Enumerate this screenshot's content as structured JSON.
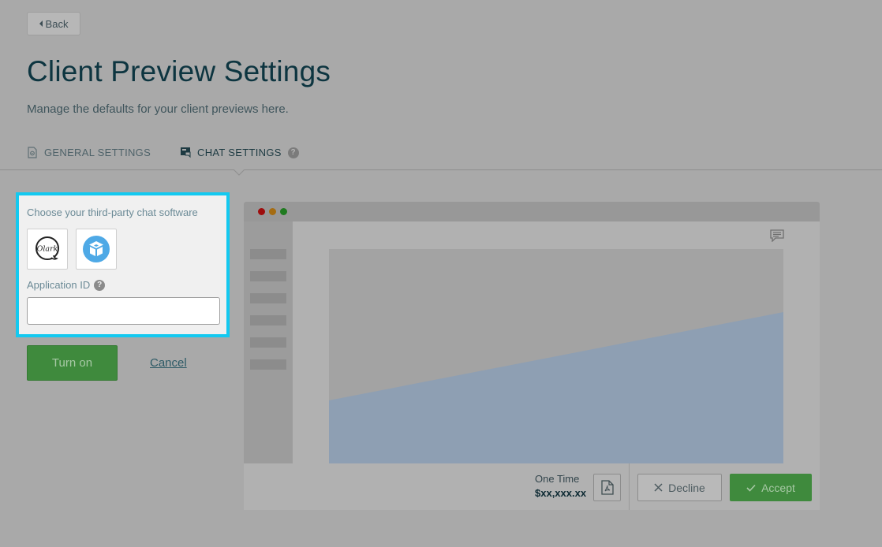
{
  "header": {
    "back_label": "Back",
    "title": "Client Preview Settings",
    "subtitle": "Manage the defaults for your client previews here."
  },
  "tabs": [
    {
      "label": "GENERAL SETTINGS",
      "active": false
    },
    {
      "label": "CHAT SETTINGS",
      "active": true
    }
  ],
  "chat_panel": {
    "prompt": "Choose your third-party chat software",
    "options": [
      {
        "name": "Olark",
        "icon": "olark-logo"
      },
      {
        "name": "",
        "icon": "blue-cube-logo"
      }
    ],
    "appid_label": "Application ID",
    "appid_value": "",
    "appid_placeholder": ""
  },
  "actions": {
    "turn_on_label": "Turn on",
    "cancel_label": "Cancel"
  },
  "preview": {
    "price_label": "One Time",
    "price_value": "$xx,xxx.xx",
    "decline_label": "Decline",
    "accept_label": "Accept"
  },
  "colors": {
    "highlight": "#13c9f0",
    "accept_green": "#3f8a3d",
    "chart_fill": "#8e9fb3"
  }
}
